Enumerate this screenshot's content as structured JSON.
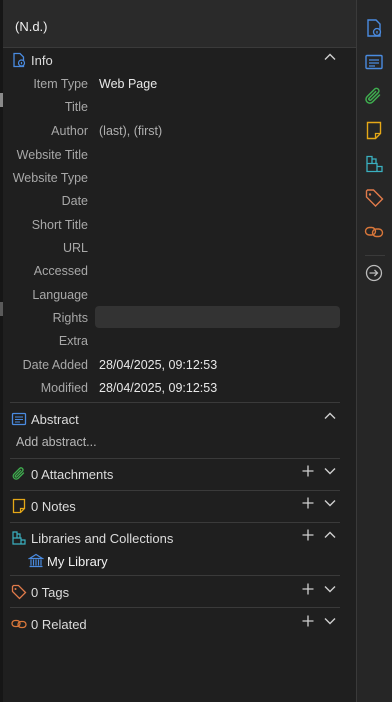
{
  "header": {
    "title": "(N.d.)"
  },
  "colors": {
    "accent": "#4a8be0",
    "attachments": "#3fae4f",
    "notes": "#e6a817",
    "libraries": "#3ab0c0",
    "tags": "#e07a4a",
    "related": "#d9773a"
  },
  "info": {
    "title": "Info",
    "icon": "info-document-icon",
    "fields": [
      {
        "label": "Item Type",
        "value": "Web Page"
      },
      {
        "label": "Title",
        "value": ""
      },
      {
        "label": "Author",
        "value": "(last),  (first)"
      },
      {
        "label": "Website Title",
        "value": ""
      },
      {
        "label": "Website Type",
        "value": ""
      },
      {
        "label": "Date",
        "value": ""
      },
      {
        "label": "Short Title",
        "value": ""
      },
      {
        "label": "URL",
        "value": ""
      },
      {
        "label": "Accessed",
        "value": ""
      },
      {
        "label": "Language",
        "value": ""
      },
      {
        "label": "Rights",
        "value": ""
      },
      {
        "label": "Extra",
        "value": ""
      },
      {
        "label": "Date Added",
        "value": "28/04/2025, 09:12:53"
      },
      {
        "label": "Modified",
        "value": "28/04/2025, 09:12:53"
      }
    ]
  },
  "abstract": {
    "title": "Abstract",
    "placeholder": "Add abstract..."
  },
  "attachments": {
    "title": "0 Attachments"
  },
  "notes": {
    "title": "0 Notes"
  },
  "libraries": {
    "title": "Libraries and Collections",
    "items": [
      {
        "label": "My Library"
      }
    ]
  },
  "tags": {
    "title": "0 Tags"
  },
  "related": {
    "title": "0 Related"
  },
  "sidenav": {
    "items": [
      "info-icon",
      "abstract-icon",
      "attachments-icon",
      "notes-icon",
      "libraries-icon",
      "tags-icon",
      "related-icon",
      "locate-icon"
    ]
  }
}
